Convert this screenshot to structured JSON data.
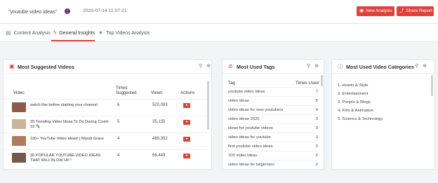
{
  "header": {
    "query": "\"youtube video ideas\"",
    "date": "2020-07-14 11:07:21",
    "new_analysis": "New Analysis",
    "share_report": "Share Report"
  },
  "tabs": [
    {
      "label": "Content Analysis",
      "icon": "clipboard-icon"
    },
    {
      "label": "General Insights",
      "icon": "pulse-icon",
      "active": true
    },
    {
      "label": "Top Videos Analysis",
      "icon": "star-icon"
    }
  ],
  "suggested": {
    "title": "Most Suggested Videos",
    "col_video": "Video",
    "col_times": "Times Suggested",
    "col_views": "Views",
    "col_actions": "Actions",
    "rows": [
      {
        "title": "watch this before starting your channel",
        "times": "6",
        "views": "520,083",
        "thumb": "#8a5a4a"
      },
      {
        "title": "20 Trending Video Ideas To Do During Covid-19 🦠",
        "times": "5",
        "views": "25,135",
        "thumb": "#c9b59c"
      },
      {
        "title": "100+ YouTube Video Ideas! | Mandi Grace",
        "times": "4",
        "views": "469,352",
        "thumb": "#b07a5e"
      },
      {
        "title": "30 POPULAR YOUTUBE VIDEO IDEAS THAT WILL BLOW UP !",
        "times": "4",
        "views": "66,449",
        "thumb": "#6f5a50"
      }
    ]
  },
  "tags": {
    "title": "Most Used Tags",
    "col_tag": "Tag",
    "col_times": "Times Used",
    "rows": [
      {
        "tag": "youtube video ideas",
        "count": "7"
      },
      {
        "tag": "video ideas",
        "count": "5"
      },
      {
        "tag": "video ideas for new youtubers",
        "count": "4"
      },
      {
        "tag": "video ideas 2020",
        "count": "3"
      },
      {
        "tag": "ideas for youtube videos",
        "count": "3"
      },
      {
        "tag": "video ideas for youtube",
        "count": "3"
      },
      {
        "tag": "first youtube video ideas",
        "count": "2"
      },
      {
        "tag": "100 video ideas",
        "count": "2"
      },
      {
        "tag": "video ideas for beginners",
        "count": "2"
      }
    ]
  },
  "categories": {
    "title": "Most Used Video Categories",
    "items": [
      "1. Howto & Style",
      "2. Entertainment",
      "3. People & Blogs",
      "4. Film & Animation",
      "5. Science & Technology"
    ]
  },
  "colors": {
    "accent": "#e0403a"
  }
}
